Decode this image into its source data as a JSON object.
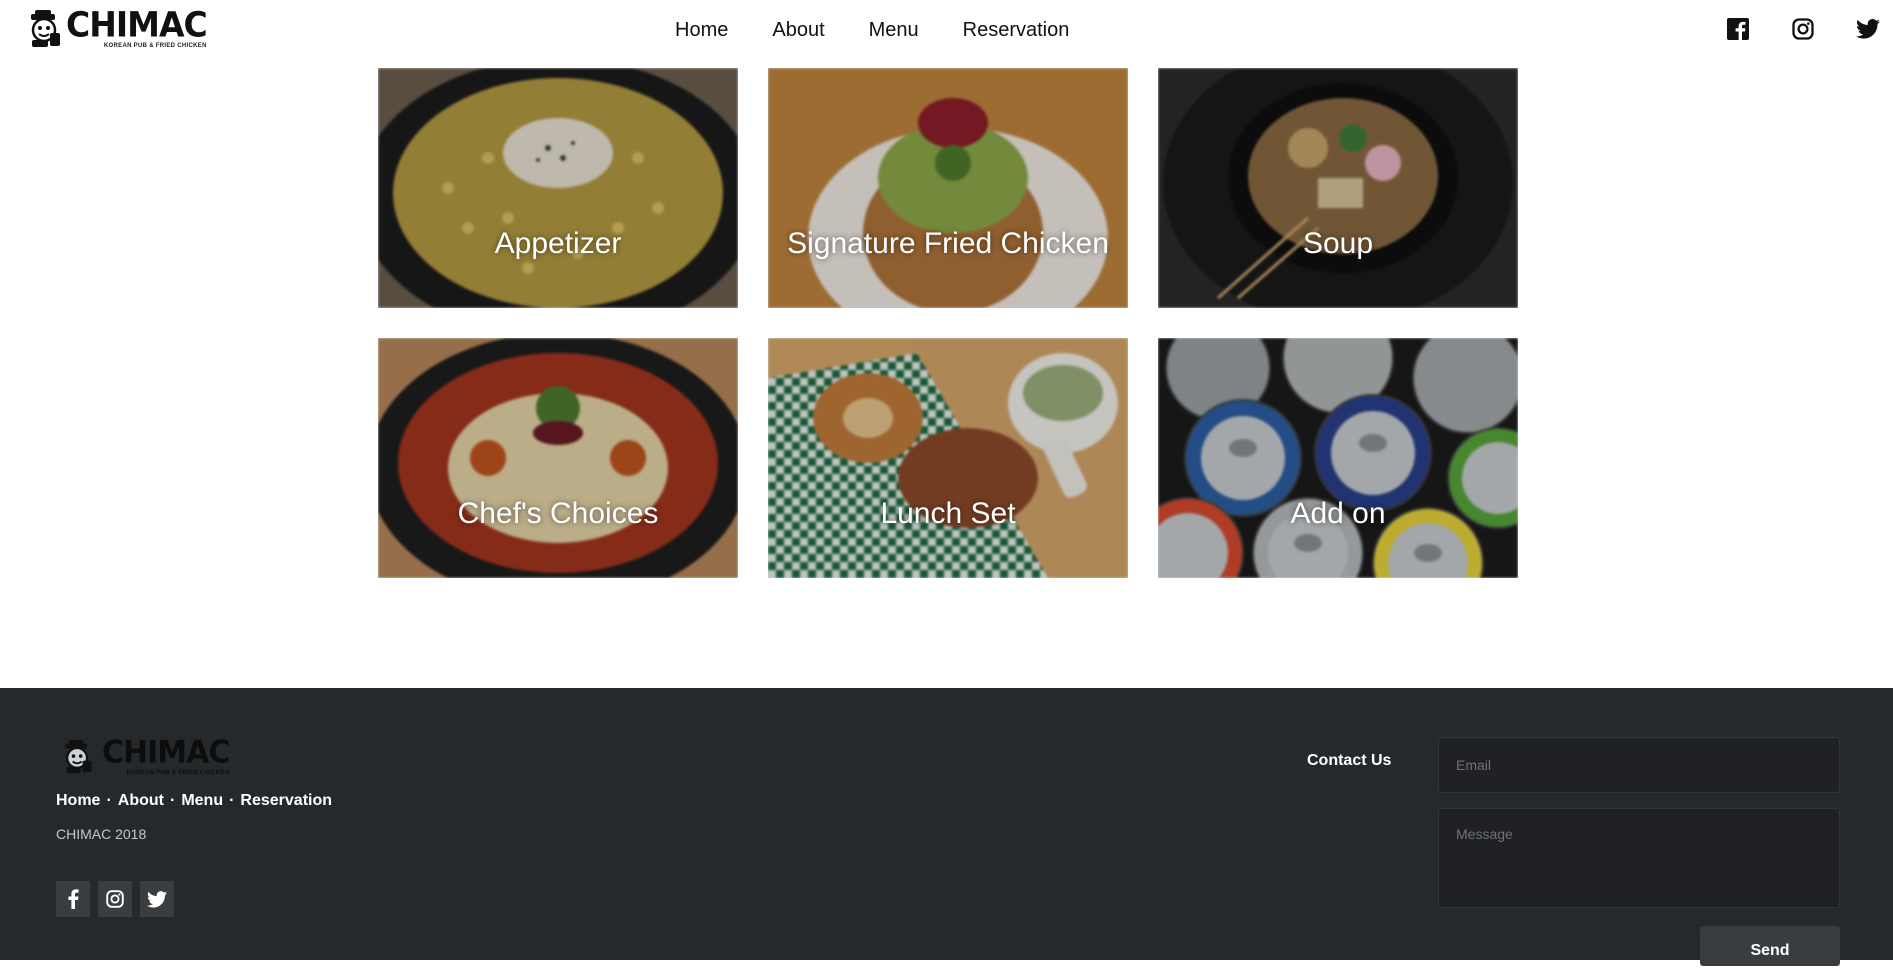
{
  "brand": {
    "name": "CHIMAC",
    "tagline": "KOREAN PUB & FRIED CHICKEN"
  },
  "nav": {
    "items": [
      {
        "label": "Home"
      },
      {
        "label": "About"
      },
      {
        "label": "Menu"
      },
      {
        "label": "Reservation"
      }
    ]
  },
  "social": {
    "icons": [
      "facebook-icon",
      "instagram-icon",
      "twitter-icon"
    ]
  },
  "menu_categories": [
    {
      "label": "Appetizer"
    },
    {
      "label": "Signature Fried Chicken"
    },
    {
      "label": "Soup"
    },
    {
      "label": "Chef's Choices"
    },
    {
      "label": "Lunch Set"
    },
    {
      "label": "Add on"
    }
  ],
  "footer": {
    "nav": [
      {
        "label": "Home"
      },
      {
        "label": "About"
      },
      {
        "label": "Menu"
      },
      {
        "label": "Reservation"
      }
    ],
    "separator": "·",
    "copyright": "CHIMAC 2018",
    "contact_label": "Contact Us",
    "email_placeholder": "Email",
    "message_placeholder": "Message",
    "send_label": "Send"
  },
  "colors": {
    "footer_bg": "#26292c",
    "field_bg": "#202124",
    "button_bg": "#3a3d40",
    "header_bg": "#ffffff"
  }
}
